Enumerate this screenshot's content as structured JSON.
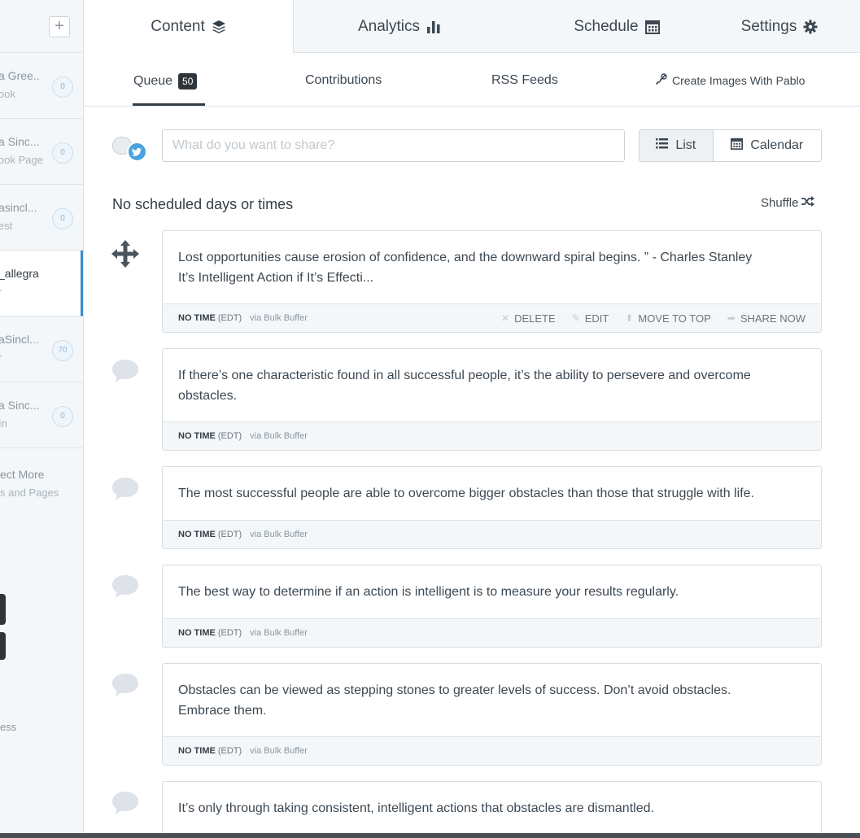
{
  "sidebar": {
    "add_label": "+",
    "accounts": [
      {
        "name": "a Gree..",
        "type": "ook",
        "count": "0",
        "active": false
      },
      {
        "name": "a Sinc...",
        "type": "ook Page",
        "count": "0",
        "active": false
      },
      {
        "name": "asincl...",
        "type": "est",
        "count": "0",
        "active": false
      },
      {
        "name": "_allegra",
        "type": "r",
        "count": "",
        "active": true
      },
      {
        "name": "aSincl...",
        "type": "r",
        "count": "70",
        "active": false
      },
      {
        "name": "a Sinc...",
        "type": "In",
        "count": "0",
        "active": false
      }
    ],
    "connect_label": "ect More",
    "connect_sub": "s and Pages",
    "bottom_label": "ess"
  },
  "tabs": [
    {
      "label": "Content",
      "icon": "layers-icon"
    },
    {
      "label": "Analytics",
      "icon": "bar-chart-icon"
    },
    {
      "label": "Schedule",
      "icon": "calendar-icon"
    },
    {
      "label": "Settings",
      "icon": "gear-icon"
    }
  ],
  "subtabs": {
    "queue_label": "Queue",
    "queue_count": "50",
    "contributions_label": "Contributions",
    "rss_label": "RSS Feeds",
    "pablo_label": "Create Images With Pablo"
  },
  "composer": {
    "placeholder": "What do you want to share?",
    "list_label": "List",
    "calendar_label": "Calendar"
  },
  "queue": {
    "status_text": "No scheduled days or times",
    "shuffle_label": "Shuffle"
  },
  "post_meta": {
    "time_label": "NO TIME",
    "tz_label": "(EDT)",
    "via_label": "via Bulk Buffer"
  },
  "post_actions": {
    "delete": "DELETE",
    "edit": "EDIT",
    "move_to_top": "MOVE TO TOP",
    "share_now": "SHARE NOW"
  },
  "posts": [
    {
      "line1": "Lost opportunities cause erosion of confidence, and the downward spiral begins. ” - Charles Stanley",
      "line2": "It’s Intelligent Action if It’s Effecti..."
    },
    {
      "line1": "If there’s one characteristic found in all successful people, it’s the ability to persevere and overcome",
      "line2": "obstacles."
    },
    {
      "line1": "The most successful people are able to overcome bigger obstacles than those that struggle with life.",
      "line2": ""
    },
    {
      "line1": "The best way to determine if an action is intelligent is to measure your results regularly.",
      "line2": ""
    },
    {
      "line1": "Obstacles can be viewed as stepping stones to greater levels of success. Don’t avoid obstacles.",
      "line2": "Embrace them."
    },
    {
      "line1": "It’s only through taking consistent, intelligent actions that obstacles are dismantled.",
      "line2": ""
    }
  ],
  "colors": {
    "accent": "#3c8dcb",
    "twitter": "#4aa3df",
    "badge_dark": "#2f353a"
  }
}
